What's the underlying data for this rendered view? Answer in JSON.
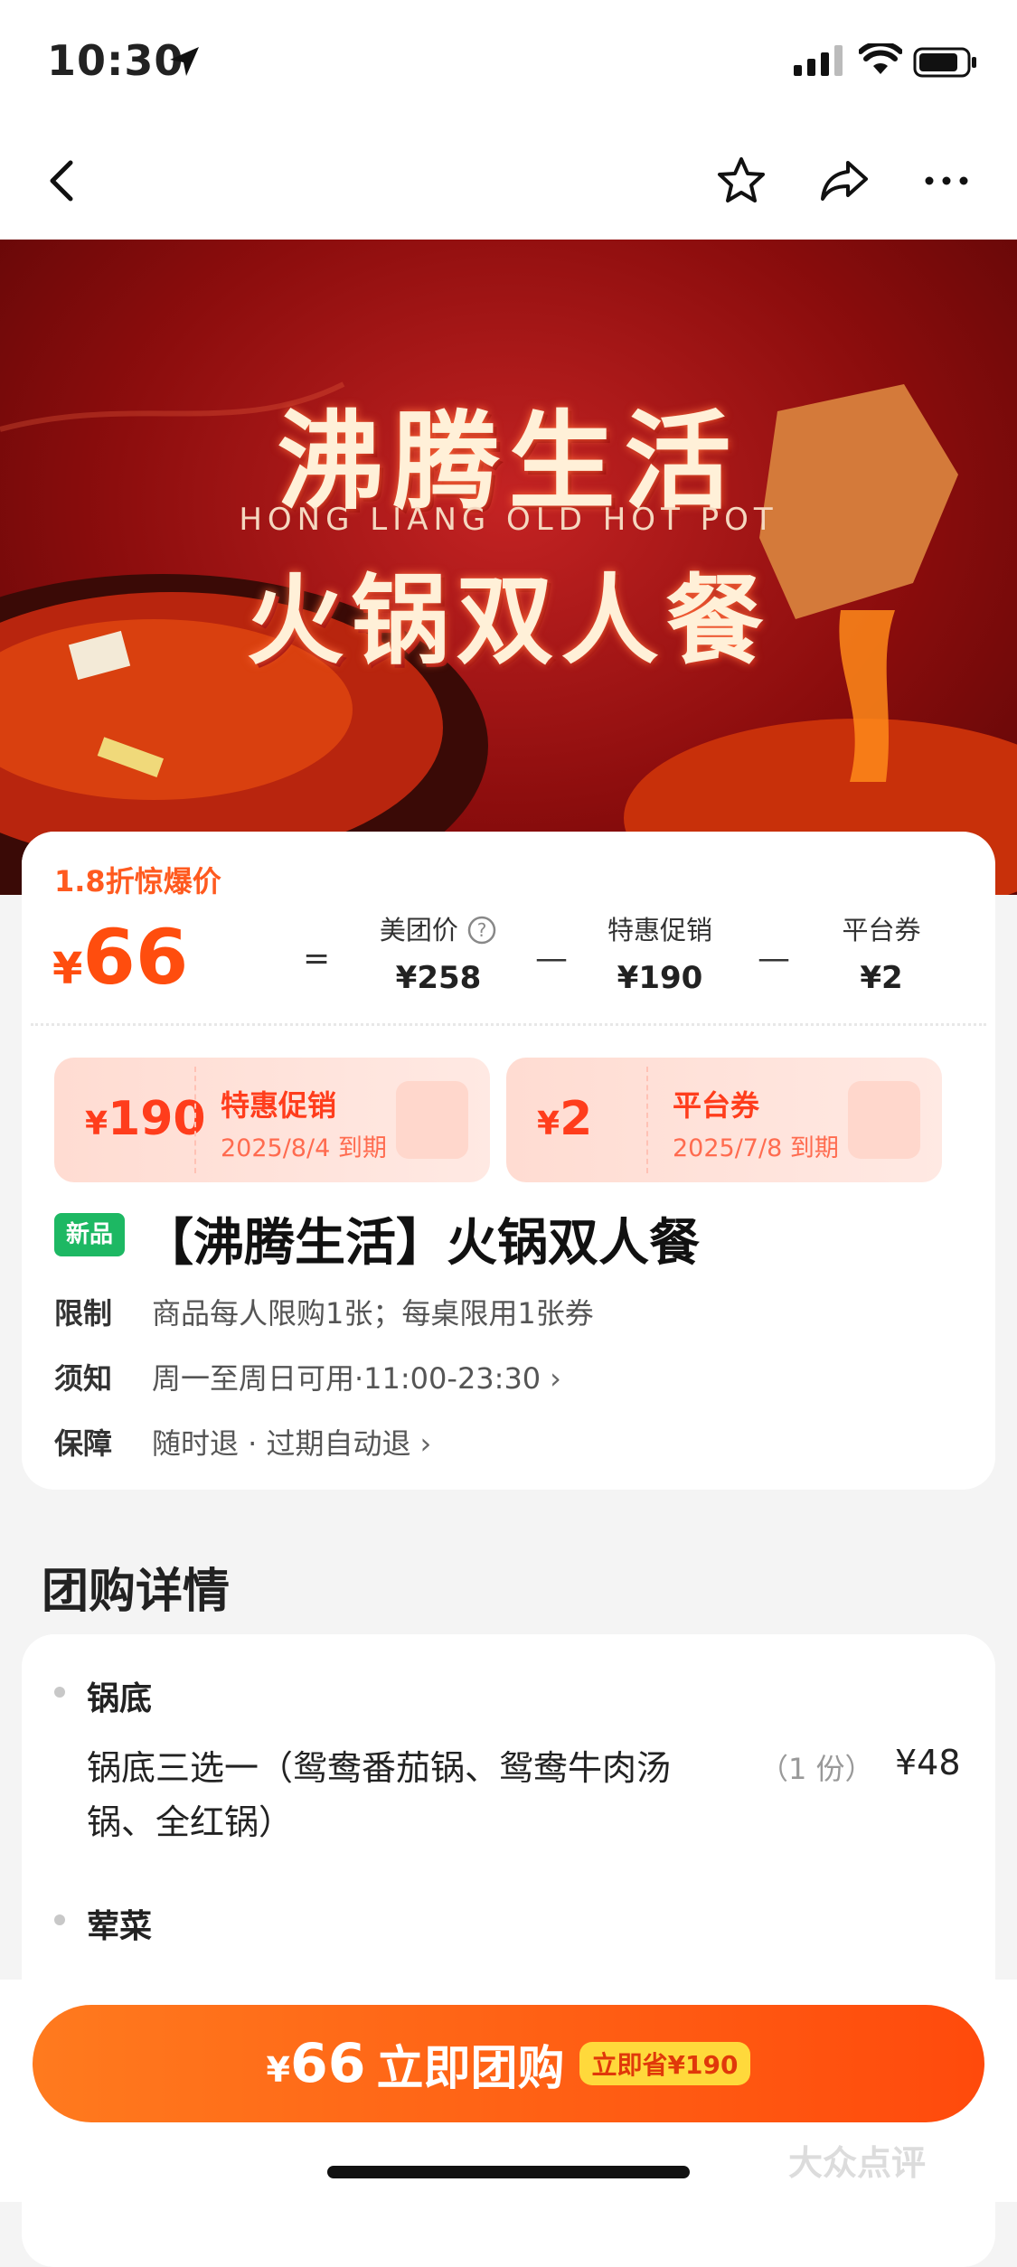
{
  "status_bar": {
    "time": "10:30"
  },
  "banner": {
    "title": "沸腾生活",
    "subtitle": "HONG LIANG OLD HOT POT",
    "title2": "火锅双人餐"
  },
  "price": {
    "discount_tag": "1.8折惊爆价",
    "currency": "¥",
    "final": "66",
    "equals": "=",
    "minus": "—",
    "columns": [
      {
        "label": "美团价",
        "value": "¥258"
      },
      {
        "label": "特惠促销",
        "value": "¥190"
      },
      {
        "label": "平台券",
        "value": "¥2"
      }
    ]
  },
  "coupons": [
    {
      "amount": "190",
      "title": "特惠促销",
      "expiry": "2025/8/4 到期"
    },
    {
      "amount": "2",
      "title": "平台券",
      "expiry": "2025/7/8 到期"
    }
  ],
  "product": {
    "badge": "新品",
    "title": "【沸腾生活】火锅双人餐",
    "info": [
      {
        "key": "限制",
        "value": "商品每人限购1张；每桌限用1张券"
      },
      {
        "key": "须知",
        "value": "周一至周日可用·11:00-23:30"
      },
      {
        "key": "保障",
        "value": "随时退 · 过期自动退"
      }
    ]
  },
  "details": {
    "heading": "团购详情",
    "sections": [
      {
        "category": "锅底",
        "item": "锅底三选一（鸳鸯番茄锅、鸳鸯牛肉汤锅、全红锅）",
        "qty": "（1 份）",
        "price": "¥48"
      },
      {
        "category": "荤菜"
      }
    ]
  },
  "buy": {
    "currency": "¥",
    "price": "66",
    "label": "立即团购",
    "save": "立即省¥190"
  },
  "watermark": "大众点评"
}
